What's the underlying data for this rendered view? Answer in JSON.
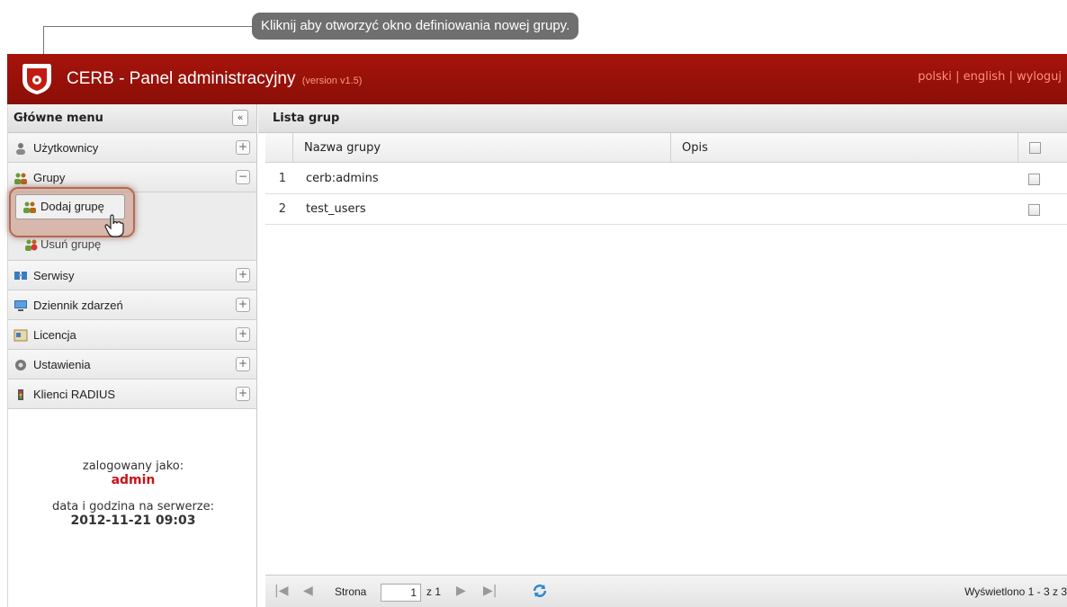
{
  "tooltip": {
    "text": "Kliknij aby otworzyć okno definiowania nowej grupy."
  },
  "header": {
    "title": "CERB - Panel administracyjny",
    "version": "(version v1.5)",
    "lang_pl": "polski",
    "lang_en": "english",
    "logout": "wyloguj",
    "separator": "|"
  },
  "sidebar": {
    "heading": "Główne menu",
    "collapse_icon": "«",
    "items": [
      {
        "label": "Użytkownicy",
        "toggle": "+",
        "icon": "user-icon"
      },
      {
        "label": "Grupy",
        "toggle": "−",
        "icon": "group-icon"
      },
      {
        "label": "Serwisy",
        "toggle": "+",
        "icon": "services-icon"
      },
      {
        "label": "Dziennik zdarzeń",
        "toggle": "+",
        "icon": "monitor-icon"
      },
      {
        "label": "Licencja",
        "toggle": "+",
        "icon": "license-icon"
      },
      {
        "label": "Ustawienia",
        "toggle": "+",
        "icon": "settings-icon"
      },
      {
        "label": "Klienci RADIUS",
        "toggle": "+",
        "icon": "radius-icon"
      }
    ],
    "subitems": [
      {
        "label": "Dodaj grupę",
        "icon": "add-group-icon"
      },
      {
        "label": "Usuń grupę",
        "icon": "remove-group-icon"
      }
    ],
    "logged_in_label": "zalogowany jako:",
    "user": "admin",
    "server_time_label": "data i godzina na serwerze:",
    "server_time": "2012-11-21 09:03"
  },
  "main": {
    "heading": "Lista grup",
    "columns": {
      "name": "Nazwa grupy",
      "desc": "Opis"
    },
    "rows": [
      {
        "num": "1",
        "name": "cerb:admins",
        "desc": ""
      },
      {
        "num": "2",
        "name": "test_users",
        "desc": ""
      }
    ],
    "pager": {
      "page_label": "Strona",
      "page_value": "1",
      "of_label": "z 1",
      "status": "Wyświetlono 1 - 3 z 3"
    }
  },
  "colors": {
    "header_red": "#9b1209",
    "user_red": "#c8141a",
    "tooltip_gray": "#6f6f6f"
  }
}
